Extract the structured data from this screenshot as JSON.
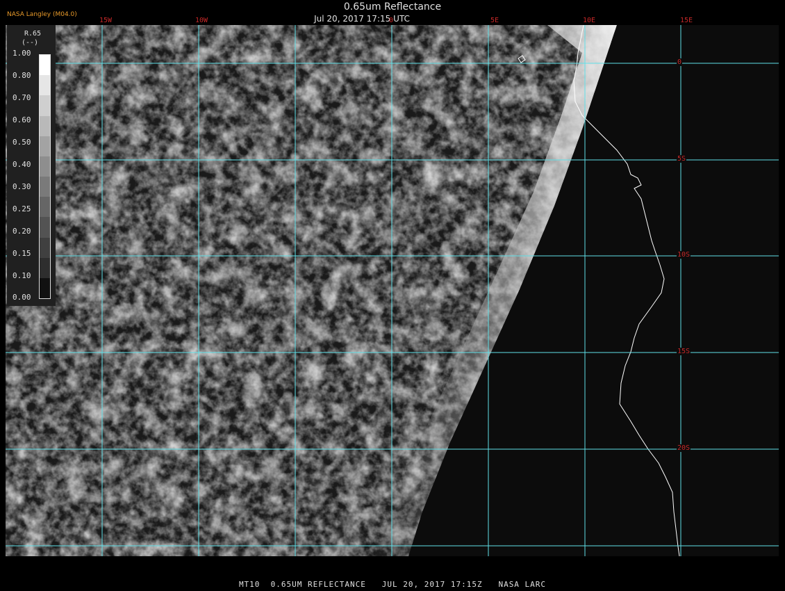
{
  "header": {
    "credit": "NASA Langley (M04.0)",
    "title": "0.65um Reflectance",
    "timestamp": "Jul 20, 2017 17:15 UTC"
  },
  "longitude_labels": [
    "15W",
    "10W",
    "0",
    "5E",
    "10E",
    "15E"
  ],
  "latitude_labels": [
    "0",
    "5S",
    "10S",
    "15S",
    "20S"
  ],
  "legend": {
    "variable": "R.65",
    "unit": "(--)",
    "ticks": [
      "1.00",
      "0.80",
      "0.70",
      "0.60",
      "0.50",
      "0.40",
      "0.30",
      "0.25",
      "0.20",
      "0.15",
      "0.10",
      "0.00"
    ]
  },
  "footer": "MT10  0.65UM REFLECTANCE   JUL 20, 2017 17:15Z   NASA LARC",
  "colors": {
    "grid": "#5fe0e8",
    "label": "#c62828",
    "credit": "#e89a2a",
    "coastline": "#ffffff",
    "background": "#0c0c0c"
  }
}
